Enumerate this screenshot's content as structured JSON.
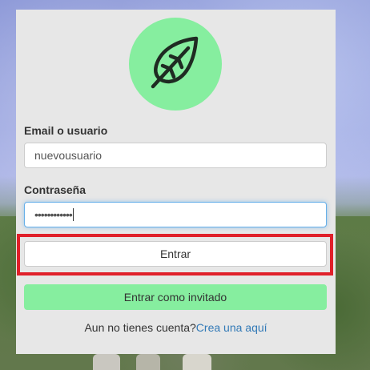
{
  "form": {
    "email_label": "Email o usuario",
    "email_value": "nuevousuario",
    "password_label": "Contraseña",
    "password_value": "••••••••••••",
    "login_button": "Entrar",
    "guest_button": "Entrar como invitado",
    "signup_prompt": "Aun no tienes cuenta?",
    "signup_link": "Crea una aquí"
  },
  "icons": {
    "logo": "leaf-icon"
  },
  "colors": {
    "accent_green": "#86ee9f",
    "link_blue": "#337ab7",
    "highlight_red": "#e0202a",
    "card_background": "#e7e7e7"
  }
}
